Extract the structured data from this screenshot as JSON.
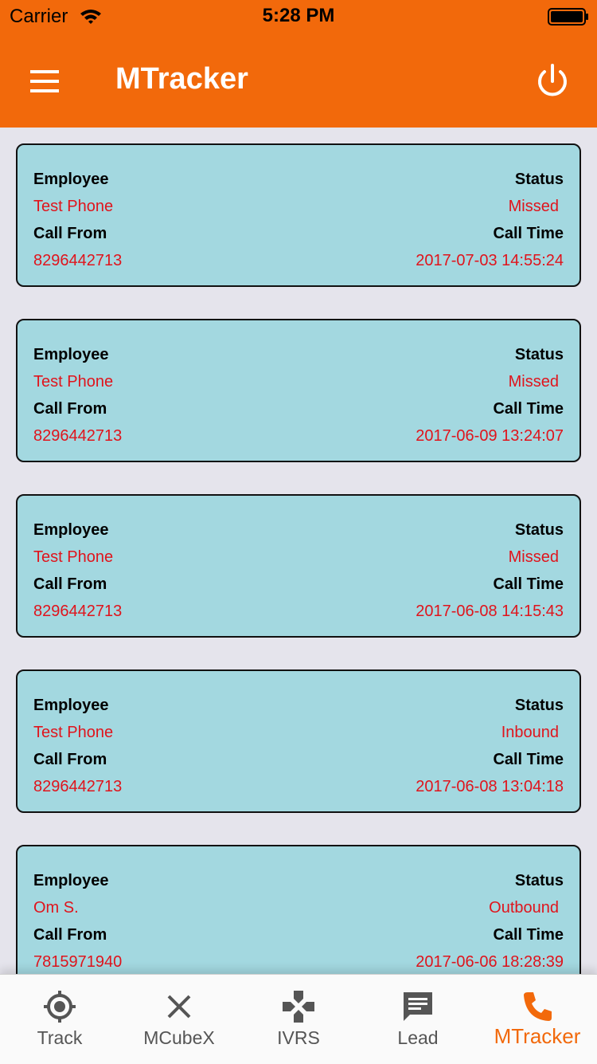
{
  "status_bar": {
    "carrier": "Carrier",
    "time": "5:28 PM",
    "wifi_icon": "wifi-icon",
    "battery_icon": "battery-icon"
  },
  "app_bar": {
    "title": "MTracker",
    "menu_icon": "menu-icon",
    "power_icon": "power-icon",
    "color": "#f2690b"
  },
  "labels": {
    "employee": "Employee",
    "status": "Status",
    "call_from": "Call From",
    "call_time": "Call Time"
  },
  "calls": [
    {
      "employee": "Test Phone",
      "status": "Missed",
      "call_from": "8296442713",
      "call_time": "2017-07-03 14:55:24"
    },
    {
      "employee": "Test Phone",
      "status": "Missed",
      "call_from": "8296442713",
      "call_time": "2017-06-09 13:24:07"
    },
    {
      "employee": "Test Phone",
      "status": "Missed",
      "call_from": "8296442713",
      "call_time": "2017-06-08 14:15:43"
    },
    {
      "employee": "Test Phone",
      "status": "Inbound",
      "call_from": "8296442713",
      "call_time": "2017-06-08 13:04:18"
    },
    {
      "employee": "Om S.",
      "status": "Outbound",
      "call_from": "7815971940",
      "call_time": "2017-06-06 18:28:39"
    }
  ],
  "tabs": [
    {
      "label": "Track",
      "icon": "crosshair-icon",
      "active": false
    },
    {
      "label": "MCubeX",
      "icon": "close-icon",
      "active": false
    },
    {
      "label": "IVRS",
      "icon": "gamepad-icon",
      "active": false
    },
    {
      "label": "Lead",
      "icon": "message-icon",
      "active": false
    },
    {
      "label": "MTracker",
      "icon": "phone-icon",
      "active": true
    }
  ],
  "colors": {
    "accent": "#f2690b",
    "card_background": "#a3d8e0",
    "value_text": "#e0141c",
    "page_background": "#e5e4ec"
  }
}
